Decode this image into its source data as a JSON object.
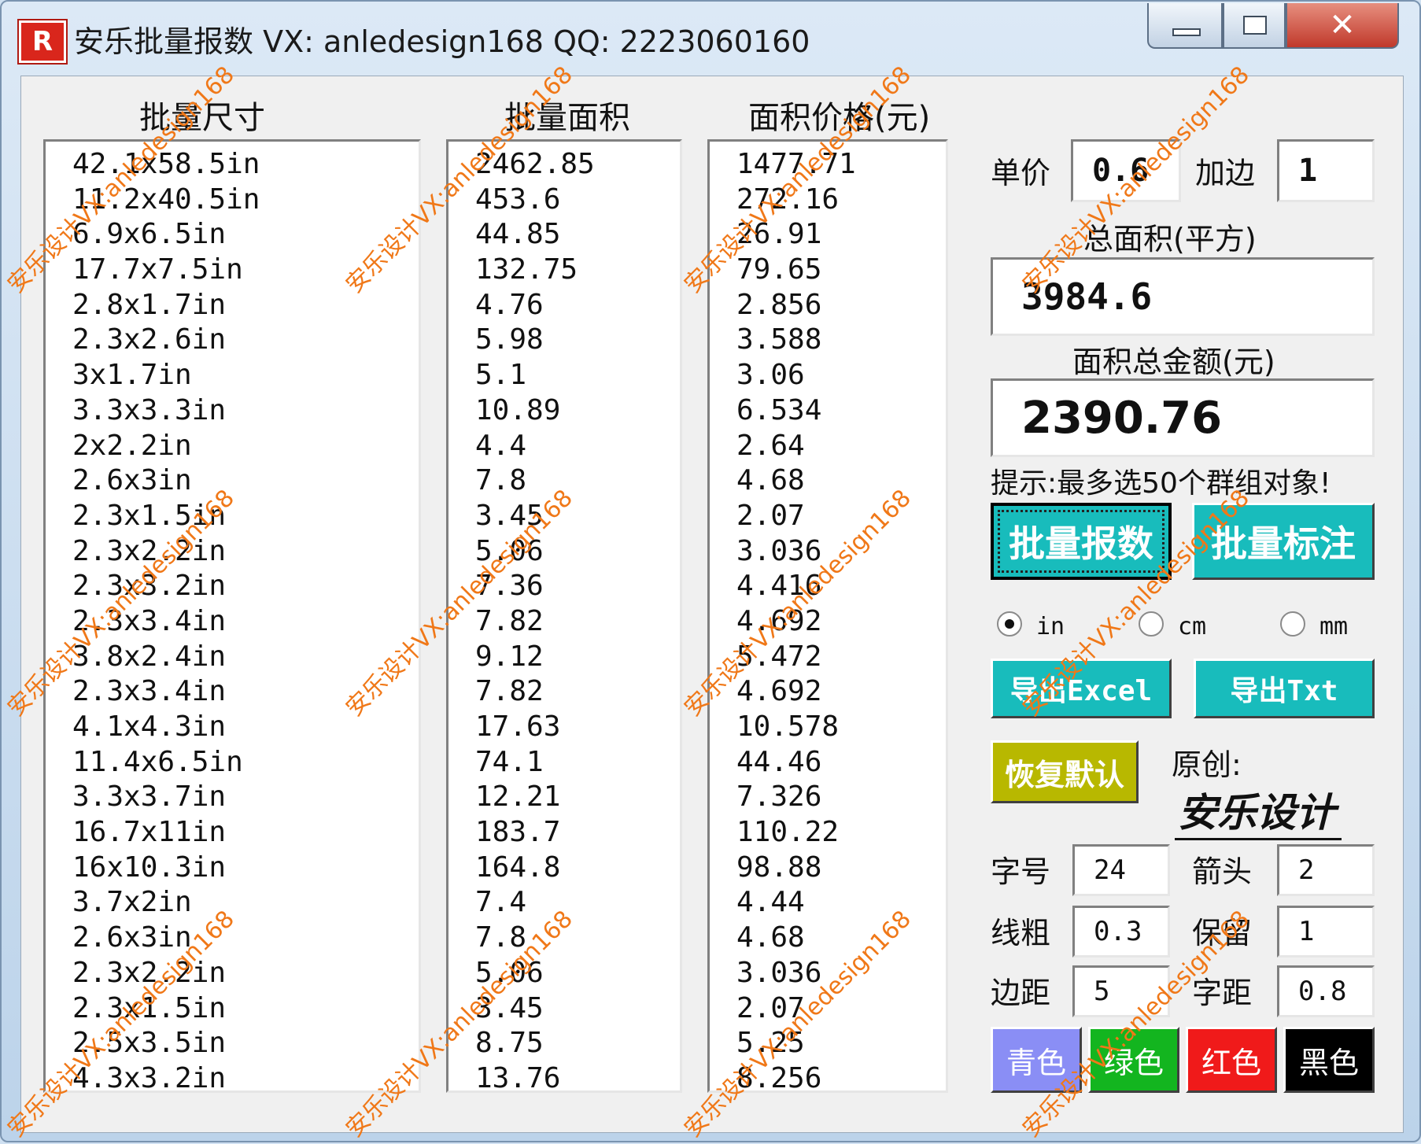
{
  "window": {
    "app_icon_text": "R",
    "title": "安乐批量报数 VX: anledesign168  QQ: 2223060160",
    "close_glyph": "✕"
  },
  "columns": {
    "sizes_header": "批量尺寸",
    "areas_header": "批量面积",
    "prices_header": "面积价格(元)"
  },
  "sizes": [
    "42.1x58.5in",
    "11.2x40.5in",
    "6.9x6.5in",
    "17.7x7.5in",
    "2.8x1.7in",
    "2.3x2.6in",
    "3x1.7in",
    "3.3x3.3in",
    "2x2.2in",
    "2.6x3in",
    "2.3x1.5in",
    "2.3x2.2in",
    "2.3x3.2in",
    "2.3x3.4in",
    "3.8x2.4in",
    "2.3x3.4in",
    "4.1x4.3in",
    "11.4x6.5in",
    "3.3x3.7in",
    "16.7x11in",
    "16x10.3in",
    "3.7x2in",
    "2.6x3in",
    "2.3x2.2in",
    "2.3x1.5in",
    "2.5x3.5in",
    "4.3x3.2in"
  ],
  "areas": [
    "2462.85",
    "453.6",
    "44.85",
    "132.75",
    "4.76",
    "5.98",
    "5.1",
    "10.89",
    "4.4",
    "7.8",
    "3.45",
    "5.06",
    "7.36",
    "7.82",
    "9.12",
    "7.82",
    "17.63",
    "74.1",
    "12.21",
    "183.7",
    "164.8",
    "7.4",
    "7.8",
    "5.06",
    "3.45",
    "8.75",
    "13.76"
  ],
  "prices": [
    "1477.71",
    "272.16",
    "26.91",
    "79.65",
    "2.856",
    "3.588",
    "3.06",
    "6.534",
    "2.64",
    "4.68",
    "2.07",
    "3.036",
    "4.416",
    "4.692",
    "5.472",
    "4.692",
    "10.578",
    "44.46",
    "7.326",
    "110.22",
    "98.88",
    "4.44",
    "4.68",
    "3.036",
    "2.07",
    "5.25",
    "8.256"
  ],
  "settings": {
    "unit_price_label": "单价",
    "unit_price_value": "0.6",
    "bleed_label": "加边",
    "bleed_value": "1",
    "total_area_label": "总面积(平方)",
    "total_area_value": "3984.6",
    "total_amount_label": "面积总金额(元)",
    "total_amount_value": "2390.76",
    "hint": "提示:最多选50个群组对象!"
  },
  "buttons": {
    "batch_quote": "批量报数",
    "batch_annotate": "批量标注",
    "export_excel": "导出Excel",
    "export_txt": "导出Txt",
    "restore_default": "恢复默认"
  },
  "units": {
    "options": [
      "in",
      "cm",
      "mm"
    ],
    "selected": "in"
  },
  "credit": {
    "label": "原创:",
    "signature": "安乐设计"
  },
  "params": {
    "font_size_label": "字号",
    "font_size_value": "24",
    "arrow_label": "箭头",
    "arrow_value": "2",
    "line_width_label": "线粗",
    "line_width_value": "0.3",
    "decimals_label": "保留",
    "decimals_value": "1",
    "margin_label": "边距",
    "margin_value": "5",
    "char_spacing_label": "字距",
    "char_spacing_value": "0.8"
  },
  "colors": [
    {
      "label": "青色",
      "bg": "#8a8ef5"
    },
    {
      "label": "绿色",
      "bg": "#13b51f"
    },
    {
      "label": "红色",
      "bg": "#f01a1a"
    },
    {
      "label": "黑色",
      "bg": "#000000"
    }
  ],
  "theme": {
    "teal": "#18bcbc",
    "olive": "#b8b800",
    "watermark": "#f07818"
  },
  "watermark": "安乐设计VX:anledesign168"
}
